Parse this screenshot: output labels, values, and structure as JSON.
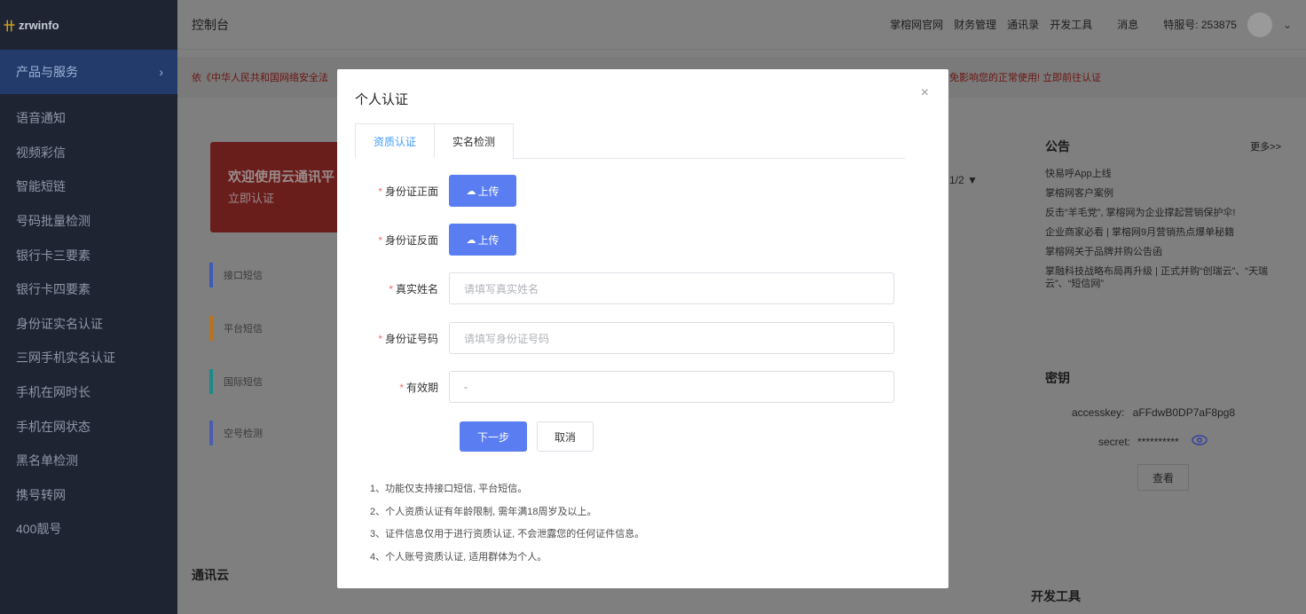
{
  "app": {
    "logo_text": "zrwinfo"
  },
  "sidebar": {
    "product_label": "产品与服务",
    "items": [
      "语音通知",
      "视频彩信",
      "智能短链",
      "号码批量检测",
      "银行卡三要素",
      "银行卡四要素",
      "身份证实名认证",
      "三网手机实名认证",
      "手机在网时长",
      "手机在网状态",
      "黑名单检测",
      "携号转网",
      "400靓号"
    ]
  },
  "header": {
    "title": "控制台",
    "nav": [
      "掌榕网官网",
      "财务管理",
      "通讯录",
      "开发工具",
      "消息",
      "特服号: 253875"
    ]
  },
  "notice": {
    "left": "依《中华人民共和国网络安全法",
    "right": "免影响您的正常使用! 立即前往认证"
  },
  "background": {
    "welcome_title": "欢迎使用云通讯平",
    "welcome_sub": "立即认证",
    "side_items": [
      "接口短信",
      "平台短信",
      "国际短信",
      "空号检测"
    ],
    "pagination": "1/2 ▼",
    "section_title": "通讯云",
    "dev_title": "开发工具"
  },
  "announcements": {
    "title": "公告",
    "more": "更多>>",
    "items": [
      "快易呼App上线",
      "掌榕网客户案例",
      "反击“羊毛党”, 掌榕网为企业撑起营销保护伞!",
      "企业商家必看 | 掌榕网9月营销热点爆单秘籍",
      "掌榕网关于品牌并购公告函",
      "掌融科技战略布局再升级 | 正式并购“创瑞云”、“天瑞云”、“短信网”"
    ]
  },
  "keys": {
    "title": "密钥",
    "accesskey_label": "accesskey:",
    "accesskey_value": "aFFdwB0DP7aF8pg8",
    "secret_label": "secret:",
    "secret_value": "**********",
    "view_button": "查看"
  },
  "modal": {
    "title": "个人认证",
    "close": "×",
    "tabs": [
      "资质认证",
      "实名检测"
    ],
    "fields": {
      "id_front": "身份证正面",
      "id_back": "身份证反面",
      "upload": "上传",
      "name": "真实姓名",
      "name_placeholder": "请填写真实姓名",
      "id_number": "身份证号码",
      "id_number_placeholder": "请填写身份证号码",
      "validity": "有效期",
      "validity_value": "-",
      "required": "*"
    },
    "next": "下一步",
    "cancel": "取消",
    "notes": [
      "1、功能仅支持接口短信, 平台短信。",
      "2、个人资质认证有年龄限制, 需年满18周岁及以上。",
      "3、证件信息仅用于进行资质认证, 不会泄露您的任何证件信息。",
      "4、个人账号资质认证, 适用群体为个人。"
    ]
  },
  "colors": {
    "primary": "#5a7df1",
    "active_tab": "#409eff",
    "required": "#f56c6c",
    "sidebar": "#1f2433"
  }
}
